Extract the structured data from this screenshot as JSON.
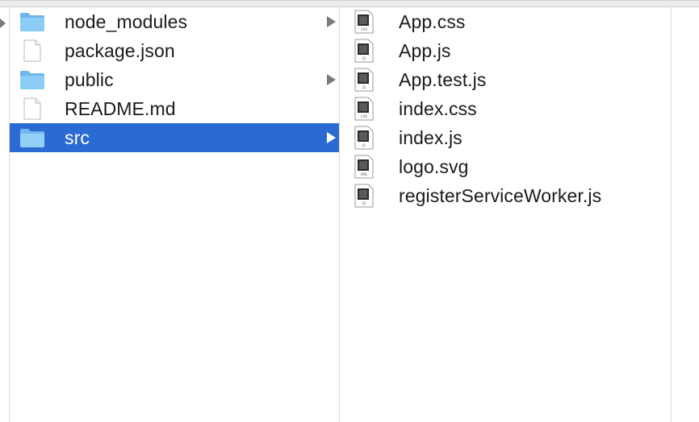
{
  "columns": [
    {
      "items": [
        {
          "label": "node_modules",
          "icon": "folder-icon",
          "kind": "folder",
          "has_children": true,
          "selected": false
        },
        {
          "label": "package.json",
          "icon": "file-icon",
          "kind": "file",
          "has_children": false,
          "selected": false
        },
        {
          "label": "public",
          "icon": "folder-icon",
          "kind": "folder",
          "has_children": true,
          "selected": false
        },
        {
          "label": "README.md",
          "icon": "file-icon",
          "kind": "file",
          "has_children": false,
          "selected": false
        },
        {
          "label": "src",
          "icon": "folder-icon",
          "kind": "folder",
          "has_children": true,
          "selected": true
        }
      ]
    },
    {
      "items": [
        {
          "label": "App.css",
          "icon": "css-file-icon",
          "badge": "CSS"
        },
        {
          "label": "App.js",
          "icon": "js-file-icon",
          "badge": "JS"
        },
        {
          "label": "App.test.js",
          "icon": "js-file-icon",
          "badge": "JS"
        },
        {
          "label": "index.css",
          "icon": "css-file-icon",
          "badge": "CSS"
        },
        {
          "label": "index.js",
          "icon": "js-file-icon",
          "badge": "JS"
        },
        {
          "label": "logo.svg",
          "icon": "xml-file-icon",
          "badge": "XML"
        },
        {
          "label": "registerServiceWorker.js",
          "icon": "js-file-icon",
          "badge": "JS"
        }
      ]
    }
  ],
  "colors": {
    "selection": "#2a6ad3",
    "folder": "#7ec3f5",
    "text": "#1a1a1a"
  }
}
